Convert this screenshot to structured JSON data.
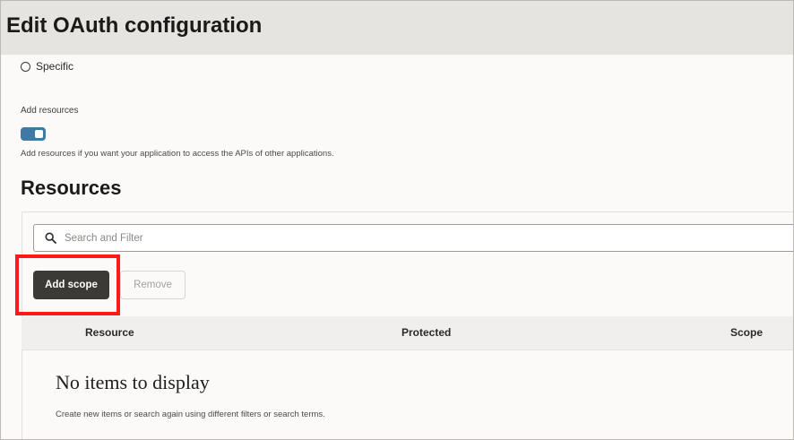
{
  "header": {
    "title": "Edit OAuth configuration"
  },
  "access": {
    "radio_label": "Specific"
  },
  "add_resources": {
    "label": "Add resources",
    "toggle_on": true,
    "helper": "Add resources if you want your application to access the APIs of other applications."
  },
  "resources": {
    "title": "Resources",
    "search": {
      "placeholder": "Search and Filter",
      "value": ""
    },
    "toolbar": {
      "add_label": "Add scope",
      "remove_label": "Remove"
    },
    "table": {
      "columns": [
        "Resource",
        "Protected",
        "Scope"
      ],
      "rows": []
    },
    "empty": {
      "title": "No items to display",
      "subtitle": "Create new items or search again using different filters or search terms."
    }
  },
  "colors": {
    "header_bg": "#e6e4e1",
    "toggle_on": "#3e7aa3",
    "primary_button": "#3b3a37",
    "highlight": "#ff1a1a"
  },
  "icons": {
    "search": "search-icon",
    "radio": "radio-button-icon"
  }
}
